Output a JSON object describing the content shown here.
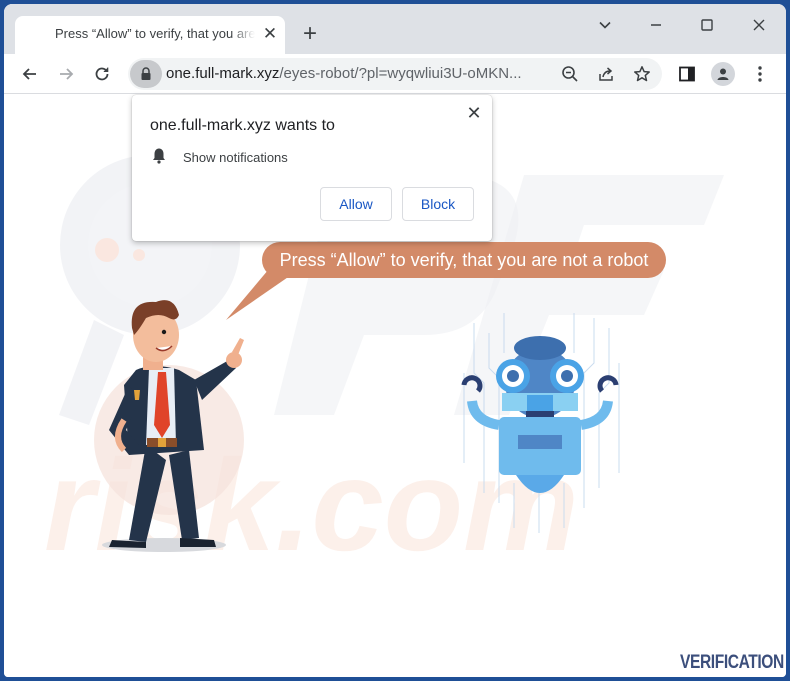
{
  "browser": {
    "tab": {
      "title": "Press “Allow” to verify, that you are not a robot",
      "close_icon": "close-icon"
    },
    "new_tab_label": "+",
    "window_controls": [
      "chevron-down-icon",
      "minimize-icon",
      "maximize-icon",
      "close-icon"
    ],
    "nav": [
      "back-arrow-icon",
      "forward-arrow-icon",
      "reload-icon"
    ],
    "address": {
      "domain": "one.full-mark.xyz",
      "path": "/eyes-robot/?pl=wyqwliui3U-oMKN...",
      "icons": [
        "lock-icon",
        "zoom-out-icon",
        "share-icon",
        "star-icon"
      ]
    },
    "toolbar_right": [
      "side-panel-icon",
      "profile-icon",
      "menu-dots-icon"
    ]
  },
  "permission_prompt": {
    "title": "one.full-mark.xyz wants to",
    "permission": "Show notifications",
    "icon": "bell-icon",
    "allow_label": "Allow",
    "block_label": "Block",
    "close_label": "✕"
  },
  "page": {
    "speech_bubble": "Press “Allow” to verify, that you are not a robot",
    "footer_label": "VERIFICATION",
    "colors": {
      "bubble": "#d38a68",
      "verification": "#3c4f7c",
      "robot_blue": "#4aa3e6",
      "suit": "#24344a",
      "tie": "#e0442a"
    }
  }
}
